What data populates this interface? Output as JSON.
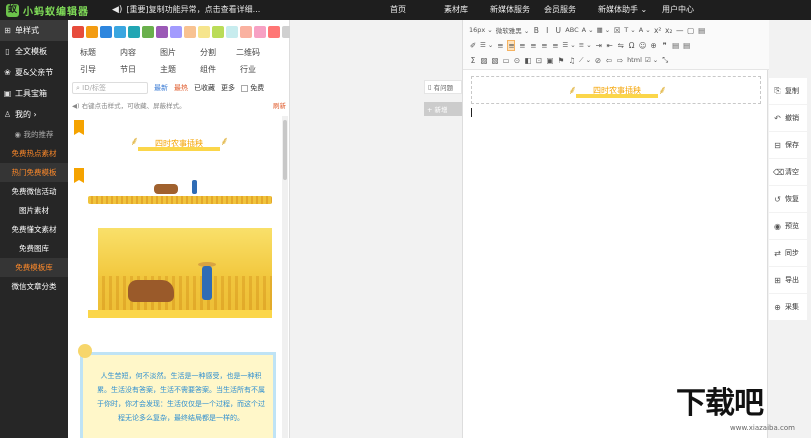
{
  "topbar": {
    "logo_text": "小蚂蚁编辑器",
    "notice": "[重要]复制功能异常，点击查看详细...",
    "nav": [
      "首页",
      "素材库",
      "新媒体服务",
      "会员服务",
      "新媒体助手 ⌄",
      "用户中心"
    ]
  },
  "sidebar": {
    "main": [
      {
        "icon": "⊞",
        "label": "单样式"
      },
      {
        "icon": "▯",
        "label": "全文模板"
      },
      {
        "icon": "❀",
        "label": "夏&父亲节"
      },
      {
        "icon": "▣",
        "label": "工具宝箱"
      },
      {
        "icon": "♙",
        "label": "我的   ›"
      }
    ],
    "sub": [
      {
        "label": "◉ 我的推荐",
        "style": "gray"
      },
      {
        "label": "免费热点素材",
        "style": "orange"
      },
      {
        "label": "热门免费模板",
        "style": "orange"
      },
      {
        "label": "免费微信活动",
        "style": "white"
      },
      {
        "label": "图片素材",
        "style": "white"
      },
      {
        "label": "免费懂文素材",
        "style": "white"
      },
      {
        "label": "免费图库",
        "style": "white"
      },
      {
        "label": "免费模板库",
        "style": "orange"
      },
      {
        "label": "微信文章分类",
        "style": "white"
      }
    ]
  },
  "panel": {
    "swatch_colors": [
      "#e74c3c",
      "#f39c12",
      "#2e86de",
      "#3aa6e0",
      "#22a6b3",
      "#6ab04c",
      "#9b59b6",
      "#a29bfe",
      "#f8c291",
      "#f6e58d",
      "#badc58",
      "#c7ecee",
      "#fab1a0",
      "#f7a1c4",
      "#ff7675",
      "#d0d0d0",
      "#4b4b4b",
      "#bdbdbd"
    ],
    "categories_row1": [
      "标题",
      "内容",
      "图片",
      "分割",
      "二维码"
    ],
    "categories_row2": [
      "引导",
      "节日",
      "主题",
      "组件",
      "行业"
    ],
    "search_placeholder": "ID/标签",
    "filters": [
      "最新",
      "最热",
      "已收藏",
      "更多"
    ],
    "free_label": "免费",
    "hint": "右键点击样式，可收藏、屏蔽样式。",
    "hint_action": "刷新",
    "banner_text": "四时农事插秧",
    "quote_text": "人生苦短，何不淡然。生活是一种感受，也是一种积累。生活没有答案，生活不需要答案。当生活所有不属于你时，你才会发现：生活仅仅是一个过程，而这个过程无论多么复杂，最终结局都是一样的。"
  },
  "preview": {
    "btn1": "有问题",
    "btn2": "+ 新增"
  },
  "editor": {
    "toolbar_row1": [
      "16px ⌄",
      "微软雅黑 ⌄",
      "B",
      "I",
      "U",
      "ABC",
      "A ⌄",
      "▦ ⌄",
      "☒",
      "T ⌄",
      "A ⌄",
      "x²",
      "x₂",
      "—",
      "▢",
      "▤"
    ],
    "toolbar_row2": [
      "✐",
      "☰ ⌄",
      "≡",
      "≡",
      "≡",
      "≡",
      "≡",
      "≡",
      "☰ ⌄",
      "≡ ⌄",
      "⇥",
      "⇤",
      "⇋",
      "Ω",
      "☺",
      "⊕",
      "❞",
      "▤",
      "▤"
    ],
    "toolbar_row3": [
      "Σ",
      "▨",
      "▧",
      "▭",
      "⊙",
      "◧",
      "⊡",
      "▣",
      "⚑",
      "♫",
      "⟋ ⌄",
      "⊘",
      "⇦",
      "⇨",
      "html",
      "☑ ⌄",
      "⤡"
    ],
    "doc_banner": "四时农事插秧"
  },
  "actions": [
    {
      "icon": "⎘",
      "label": "复制"
    },
    {
      "icon": "↶",
      "label": "撤销"
    },
    {
      "icon": "⊟",
      "label": "保存"
    },
    {
      "icon": "⌫",
      "label": "清空"
    },
    {
      "icon": "↺",
      "label": "恢复"
    },
    {
      "icon": "◉",
      "label": "预览"
    },
    {
      "icon": "⇄",
      "label": "同步"
    },
    {
      "icon": "⊞",
      "label": "导出"
    },
    {
      "icon": "⊕",
      "label": "采集"
    }
  ],
  "watermark": {
    "big": "下载吧",
    "small": "www.xiazaiba.com"
  }
}
